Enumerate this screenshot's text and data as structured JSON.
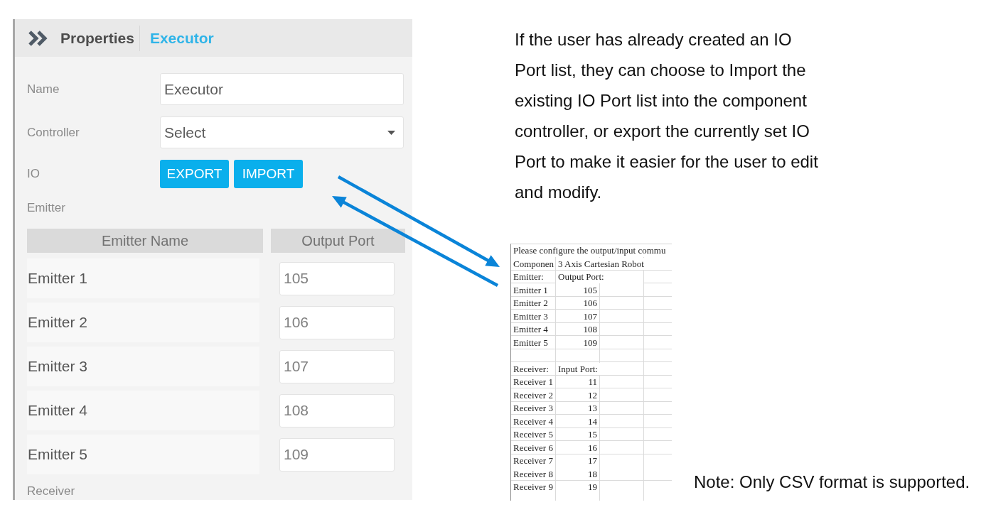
{
  "properties_panel": {
    "header": {
      "title": "Properties",
      "component": "Executor"
    },
    "fields": [
      {
        "kind": "text",
        "label": "Name",
        "value": "Executor"
      },
      {
        "kind": "select",
        "label": "Controller",
        "value": "Select"
      },
      {
        "kind": "buttons",
        "label": "IO",
        "buttons": [
          "EXPORT",
          "IMPORT"
        ]
      }
    ],
    "emitter_section": {
      "label": "Emitter",
      "columns": [
        "Emitter Name",
        "Output Port"
      ],
      "rows": [
        {
          "name": "Emitter 1",
          "port": "105"
        },
        {
          "name": "Emitter 2",
          "port": "106"
        },
        {
          "name": "Emitter 3",
          "port": "107"
        },
        {
          "name": "Emitter 4",
          "port": "108"
        },
        {
          "name": "Emitter 5",
          "port": "109"
        }
      ]
    },
    "receiver_section": {
      "label": "Receiver"
    }
  },
  "description": "If the user has already created an IO Port list, they can choose to Import the existing IO Port list into the component controller, or export the currently set IO Port to make it easier for the user to edit and modify.",
  "spreadsheet": {
    "title": "Please configure the output/input commu",
    "component": {
      "label": "Componen",
      "value": "3 Axis Cartesian Robot"
    },
    "emitter_header": {
      "name": "Emitter:",
      "port": "Output Port:"
    },
    "emitters": [
      {
        "name": "Emitter 1",
        "port": "105"
      },
      {
        "name": "Emitter 2",
        "port": "106"
      },
      {
        "name": "Emitter 3",
        "port": "107"
      },
      {
        "name": "Emitter 4",
        "port": "108"
      },
      {
        "name": "Emitter 5",
        "port": "109"
      }
    ],
    "receiver_header": {
      "name": "Receiver:",
      "port": "Input Port:"
    },
    "receivers": [
      {
        "name": "Receiver 1",
        "port": "11"
      },
      {
        "name": "Receiver 2",
        "port": "12"
      },
      {
        "name": "Receiver 3",
        "port": "13"
      },
      {
        "name": "Receiver 4",
        "port": "14"
      },
      {
        "name": "Receiver 5",
        "port": "15"
      },
      {
        "name": "Receiver 6",
        "port": "16"
      },
      {
        "name": "Receiver 7",
        "port": "17"
      },
      {
        "name": "Receiver 8",
        "port": "18"
      },
      {
        "name": "Receiver 9",
        "port": "19"
      }
    ]
  },
  "note": "Note: Only CSV format is supported."
}
